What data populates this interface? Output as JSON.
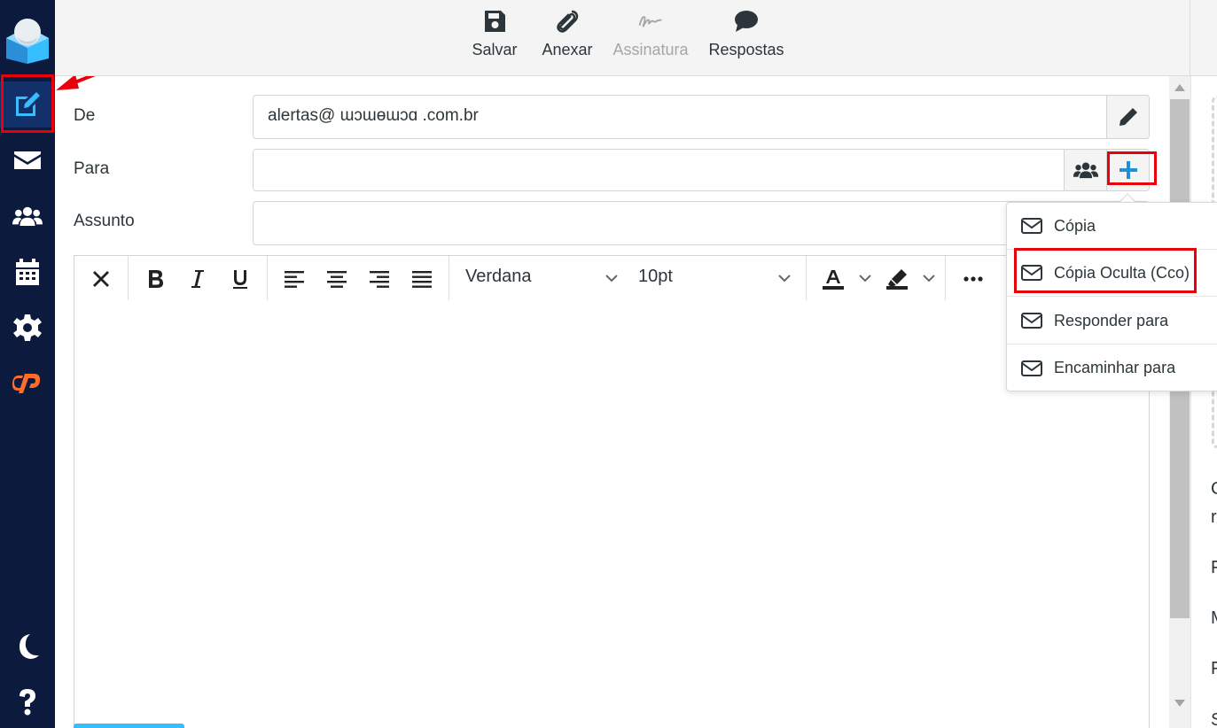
{
  "sidebar": {
    "items": [
      {
        "name": "compose",
        "icon": "compose-icon",
        "active": true
      },
      {
        "name": "mail",
        "icon": "envelope-icon"
      },
      {
        "name": "contacts",
        "icon": "users-icon"
      },
      {
        "name": "calendar",
        "icon": "calendar-icon"
      },
      {
        "name": "settings",
        "icon": "gear-icon"
      },
      {
        "name": "cpanel",
        "icon": "cpanel-icon"
      },
      {
        "name": "theme",
        "icon": "moon-icon"
      },
      {
        "name": "help",
        "icon": "question-icon"
      }
    ],
    "accent": "#37beff",
    "bg": "#0c1a3d"
  },
  "toolbar": {
    "save_label": "Salvar",
    "attach_label": "Anexar",
    "signature_label": "Assinatura",
    "responses_label": "Respostas"
  },
  "form": {
    "from_label": "De",
    "from_value": "alertas@ ɯɔɯɵɯɔɑ .com.br",
    "to_label": "Para",
    "to_value": "",
    "subject_label": "Assunto",
    "subject_value": ""
  },
  "editor": {
    "font_family": "Verdana",
    "font_size": "10pt"
  },
  "dropdown": {
    "items": [
      {
        "label": "Cópia"
      },
      {
        "label": "Cópia Oculta (Cco)"
      },
      {
        "label": "Responder para"
      },
      {
        "label": "Encaminhar para"
      }
    ]
  },
  "right_panel": {
    "partial_letters": [
      "C",
      "r",
      "F",
      "M",
      "F",
      "S"
    ]
  },
  "colors": {
    "highlight": "#e8000b",
    "plus_blue": "#1f8fd8"
  }
}
